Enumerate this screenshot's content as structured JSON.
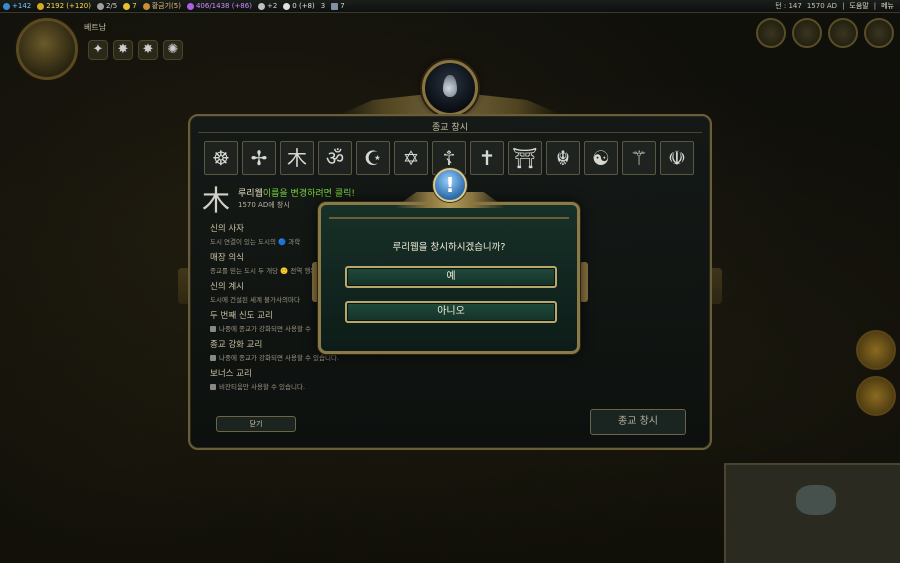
{
  "topbar": {
    "science": "+142",
    "gold": "2192 (+120)",
    "trade": "2/5",
    "happiness": "7",
    "golden_age": "황금기(5)",
    "culture": "406/1438 (+86)",
    "tourism": "+2",
    "faith": "0 (+8)",
    "faith2": "3",
    "great": "7",
    "turn": "턴 : 147",
    "year": "1570 AD",
    "help": "도움말",
    "menu": "메뉴",
    "sep": "|"
  },
  "leader": {
    "name": "베트남"
  },
  "panel": {
    "title": "종교 창시",
    "religion_icons": [
      "☸",
      "✢",
      "木",
      "ॐ",
      "☪",
      "✡",
      "☦",
      "✝",
      "⛩",
      "☬",
      "☯",
      "⚚",
      "☫"
    ],
    "selected_glyph": "木",
    "religion_name": "루리웹",
    "rename_hint": "이름을 변경하려면 클릭!",
    "founded_date": "1570 AD에 창시",
    "sections": [
      {
        "title": "신의 사자",
        "desc": "도시 연결이 있는 도시의 🔵 과학",
        "locked": false
      },
      {
        "title": "매장 의식",
        "desc": "종교를 믿는 도시 두 개당 🙂 전역 행복",
        "locked": false
      },
      {
        "title": "신의 계시",
        "desc": "도시에 건설된 세계 불가사의마다",
        "locked": false
      },
      {
        "title": "두 번째 신도 교리",
        "desc": "나중에 종교가 강화되면 사용할 수",
        "locked": true
      },
      {
        "title": "종교 강화 교리",
        "desc": "나중에 종교가 강화되면 사용할 수 있습니다.",
        "locked": true
      },
      {
        "title": "보너스 교리",
        "desc": "비잔티움만 사용할 수 있습니다.",
        "locked": true
      }
    ],
    "close_label": "닫기",
    "found_label": "종교 창시"
  },
  "confirm": {
    "badge": "!",
    "message": "루리웹을 창시하시겠습니까?",
    "yes": "예",
    "no": "아니오"
  }
}
